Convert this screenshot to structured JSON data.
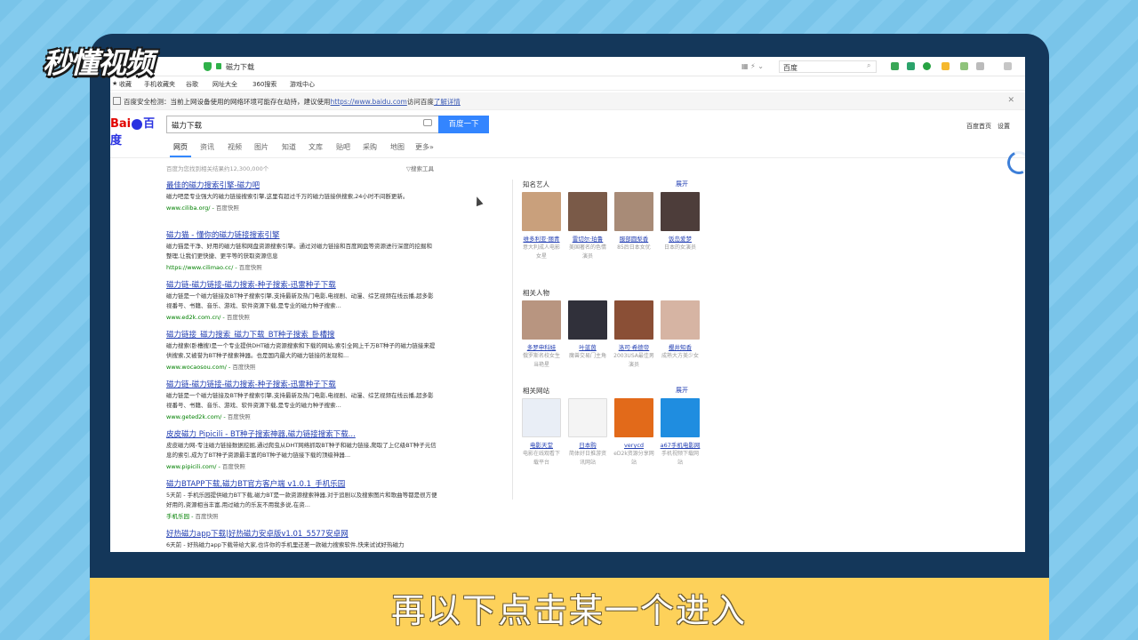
{
  "watermark": "秒懂视频",
  "subtitle": "再以下点击某一个进入",
  "browser": {
    "tab_title": "磁力下载",
    "toolbar_search": "百度",
    "favorites": [
      "收藏",
      "手机收藏夹",
      "谷歌",
      "网址大全",
      "360搜索",
      "游戏中心"
    ],
    "notice": {
      "text": "百度安全检测：当前上网设备使用的网络环境可能存在劫持，建议使用",
      "url": "https://www.baidu.com",
      "after": "访问百度",
      "link": "了解详情"
    }
  },
  "baidu": {
    "logo_left": "Bai",
    "logo_right": "百度",
    "query": "磁力下载",
    "search_button": "百度一下",
    "header_links": [
      "百度首页",
      "设置"
    ],
    "tabs": [
      "网页",
      "资讯",
      "视频",
      "图片",
      "知道",
      "文库",
      "贴吧",
      "采购",
      "地图",
      "更多»"
    ],
    "result_count": "百度为您找到相关结果约12,300,000个",
    "search_tools": "▽搜索工具"
  },
  "results": [
    {
      "title": "最佳的磁力搜索引擎-磁力吧",
      "abstract": "磁力吧是专业强大的磁力链接搜索引擎,这里有超过千万的磁力链接供搜索,24小时不间断更新。",
      "url": "www.ciliba.org/",
      "snapshot": "百度快照"
    },
    {
      "title": "磁力猫 - 懂你的磁力链接搜索引擎",
      "abstract": "磁力猫是干净、好用的磁力链和网盘资源搜索引擎。通过对磁力链接和百度网盘等资源进行深度的挖掘和整理,让我们更快捷、更平等的获取资源信息",
      "url": "https://www.cilimao.cc/",
      "snapshot": "百度快照"
    },
    {
      "title": "磁力链-磁力链接-磁力搜索-种子搜索-迅雷种子下载",
      "abstract": "磁力链是一个磁力链接及BT种子搜索引擎,支持最新及热门电影,电视剧、动漫、综艺视频在线云播,超多影视番号、书籍、音乐、游戏、软件资源下载,是专业的磁力种子搜索...",
      "url": "www.ed2k.com.cn/",
      "snapshot": "百度快照"
    },
    {
      "title": "磁力链接_磁力搜索_磁力下载_BT种子搜索_卧槽搜",
      "abstract": "磁力搜索(卧槽搜)是一个专业提供DHT磁力资源搜索和下载的网站,索引全网上千万BT种子的磁力链接来提供搜索,又被誉为BT种子搜索神器。也是国内最大的磁力链接的发现和...",
      "url": "www.wocaosou.com/",
      "snapshot": "百度快照"
    },
    {
      "title": "磁力链-磁力链接-磁力搜索-种子搜索-迅雷种子下载",
      "abstract": "磁力链是一个磁力链接及BT种子搜索引擎,支持最新及热门电影,电视剧、动漫、综艺视频在线云播,超多影视番号、书籍、音乐、游戏、软件资源下载,是专业的磁力种子搜索...",
      "url": "www.geted2k.com/",
      "snapshot": "百度快照"
    },
    {
      "title": "皮皮磁力 Pipicili - BT种子搜索神器,磁力链接搜索下载...",
      "abstract": "皮皮磁力网-专注磁力链接数据挖掘,通过爬虫从DHT网络抓取BT种子和磁力链接,爬取了上亿级BT种子元信息的索引,成为了BT种子资源最丰富的BT种子磁力链接下载的顶级神器...",
      "url": "www.pipicili.com/",
      "snapshot": "百度快照"
    },
    {
      "title": "磁力BTAPP下载,磁力BT官方客户端 v1.0.1_手机乐园",
      "abstract": "5天前 - 手机乐园提供磁力BT下载,磁力BT是一款资源搜索神器,对于追剧以及搜索图片和歌曲等都是很方便好用的,资源相当丰富,用过磁力的乐友不用我多说,在资...",
      "url": "手机乐园",
      "snapshot": "百度快照"
    },
    {
      "title": "好热磁力app下载|好热磁力安卓版v1.01_5577安卓网",
      "abstract": "6天前 - 好热磁力app下载带给大家,也许你的手机里还差一款磁力搜索软件,快来试试好热磁力",
      "url": "",
      "snapshot": ""
    }
  ],
  "sidebar": {
    "famous": {
      "title": "知名艺人",
      "more": "展开",
      "items": [
        {
          "name": "维多利亚·丽青",
          "desc": "意大利成人电影女星",
          "color": "#c9a07c"
        },
        {
          "name": "雷切尔·珀鲁",
          "desc": "美国著名的色情演员",
          "color": "#7a5a48"
        },
        {
          "name": "服部圆梨香",
          "desc": "85后日本女优",
          "color": "#a88b77"
        },
        {
          "name": "饭岛爱梦",
          "desc": "日本的女演员",
          "color": "#4d3d3a"
        }
      ]
    },
    "related_people": {
      "title": "相关人物",
      "items": [
        {
          "name": "多罗申科娃",
          "desc": "俄罗斯名校女生当艳星",
          "color": "#b89580"
        },
        {
          "name": "叶蓝茵",
          "desc": "魔兽交易门主角",
          "color": "#30303a"
        },
        {
          "name": "洛可·希德帝",
          "desc": "2003USA最佳男演员",
          "color": "#8a4f36"
        },
        {
          "name": "樱井知香",
          "desc": "成熟大方美少女",
          "color": "#d6b4a3"
        }
      ]
    },
    "related_sites": {
      "title": "相关网站",
      "more": "展开",
      "items": [
        {
          "name": "电影天堂",
          "desc": "电影在线观看下载平台",
          "color": "#2d6fb8"
        },
        {
          "name": "日本购",
          "desc": "简体好日推游资讯网站",
          "color": "#e8452e"
        },
        {
          "name": "verycd",
          "desc": "eD2k资源分享网站",
          "color": "#e26a1a"
        },
        {
          "name": "a67手机电影网",
          "desc": "手机视频下载网站",
          "color": "#1f8de0"
        }
      ]
    }
  }
}
